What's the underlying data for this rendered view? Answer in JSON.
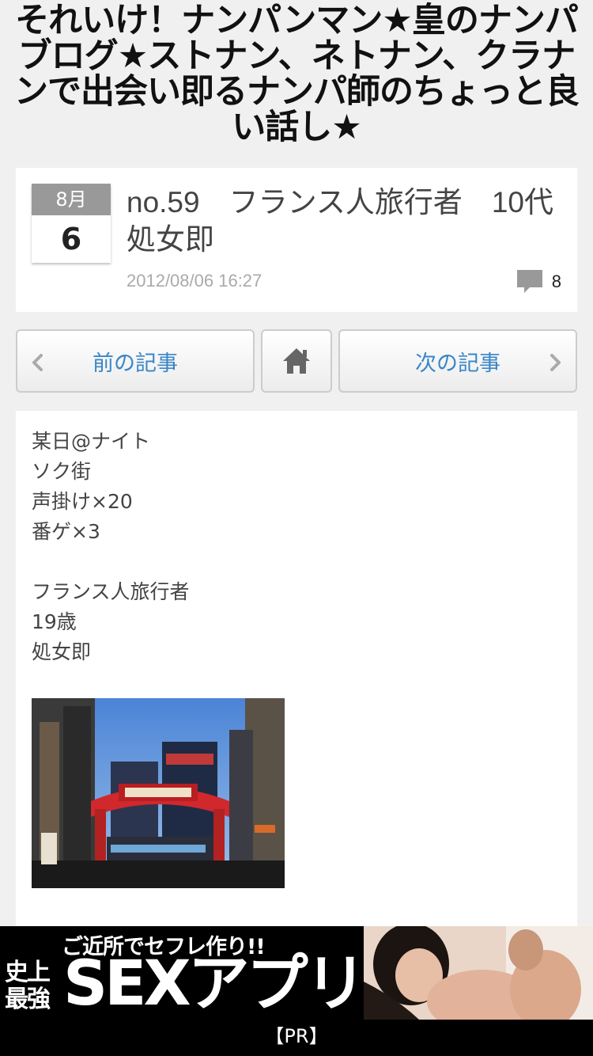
{
  "blog": {
    "title": "それいけ！ナンパンマン★皇のナンパブログ★ストナン、ネトナン、クラナンで出会い即るナンパ師のちょっと良い話し★"
  },
  "article": {
    "month": "8月",
    "day": "6",
    "title": "no.59　フランス人旅行者　10代　処女即",
    "datetime": "2012/08/06 16:27",
    "comment_count": "8",
    "comment_icon": "speech-bubble-icon"
  },
  "pager": {
    "prev_label": "前の記事",
    "home_icon": "home-icon",
    "next_label": "次の記事"
  },
  "body": {
    "lines": [
      "某日@ナイト",
      "ソク街",
      "声掛け×20",
      "番ゲ×3",
      "",
      "フランス人旅行者",
      "19歳",
      "処女即"
    ],
    "photo_icon": "city-gate-photo"
  },
  "ad": {
    "subtitle": "ご近所でセフレ作り!!",
    "small_line1": "史上",
    "small_line2": "最強",
    "main": "SEXアプリ",
    "label": "【PR】"
  },
  "colors": {
    "background": "#f0f0f0",
    "link_blue": "#3a86c8",
    "date_header": "#999999"
  }
}
